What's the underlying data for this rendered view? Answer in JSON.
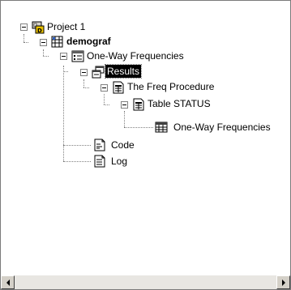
{
  "tree": {
    "nodes": [
      {
        "id": "project",
        "label": "Project 1",
        "icon": "project-icon"
      },
      {
        "id": "demograf",
        "label": "demograf",
        "icon": "dataset-icon",
        "bold": true
      },
      {
        "id": "one-way-task",
        "label": "One-Way Frequencies",
        "icon": "task-icon"
      },
      {
        "id": "results",
        "label": "Results",
        "icon": "results-icon",
        "selected": true
      },
      {
        "id": "freq-proc",
        "label": "The Freq Procedure",
        "icon": "report-icon"
      },
      {
        "id": "table-status",
        "label": "Table STATUS",
        "icon": "report-icon"
      },
      {
        "id": "one-way-output",
        "label": "One-Way Frequencies",
        "icon": "table-icon"
      },
      {
        "id": "code",
        "label": "Code",
        "icon": "code-icon"
      },
      {
        "id": "log",
        "label": "Log",
        "icon": "log-icon"
      }
    ]
  },
  "scrollbar": {
    "left_icon": "arrow-left-icon",
    "right_icon": "arrow-right-icon"
  }
}
